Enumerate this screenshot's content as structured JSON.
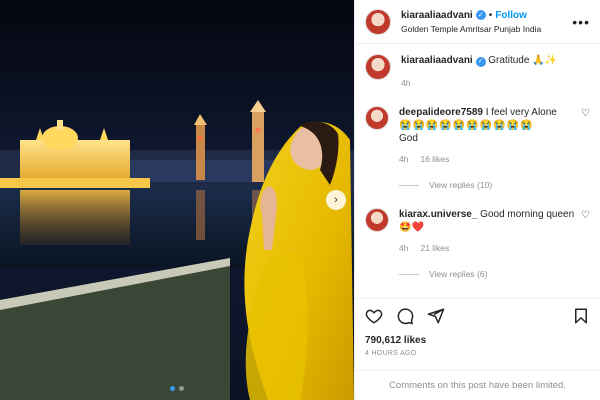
{
  "post": {
    "username": "kiaraaliaadvani",
    "follow_label": "Follow",
    "location": "Golden Temple Amritsar Punjab India",
    "more_glyph": "•••",
    "verified_glyph": "✓",
    "caption": "Gratitude 🙏✨",
    "caption_time": "4h"
  },
  "comments": [
    {
      "username": "deepalideore7589",
      "text": "I feel very Alone",
      "emojis": "😭😭😭😭😭😭😭😭😭😭",
      "text2": "God",
      "time": "4h",
      "likes": "16 likes",
      "replies": "View replies (10)"
    },
    {
      "username": "kiarax.universe_",
      "text": "Good morning queen 🤩❤️",
      "time": "4h",
      "likes": "21 likes",
      "replies": "View replies (6)"
    }
  ],
  "footer": {
    "likes": "790,612 likes",
    "ago": "4 HOURS AGO",
    "limited": "Comments on this post have been limited."
  },
  "carousel": {
    "next_glyph": "›",
    "slides": 2,
    "active": 0
  },
  "icons": [
    "heart-icon",
    "comment-icon",
    "share-icon",
    "bookmark-icon"
  ]
}
